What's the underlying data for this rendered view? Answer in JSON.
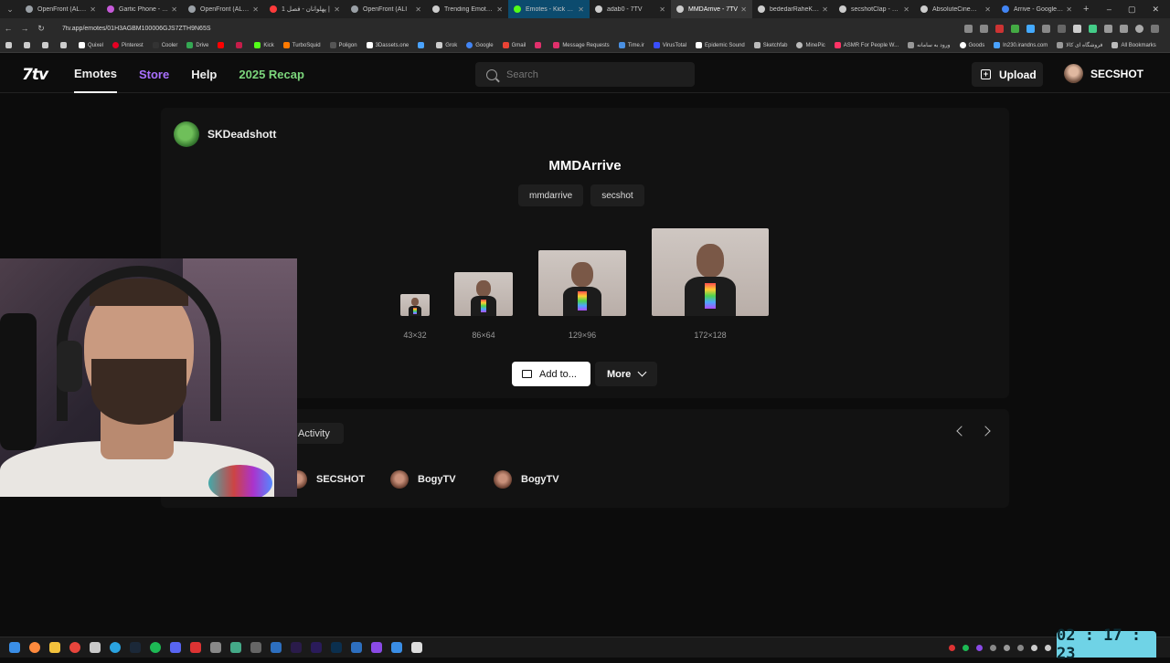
{
  "browser": {
    "tabs": [
      {
        "label": "OpenFront (ALPHA)",
        "color": "#9aa0a6"
      },
      {
        "label": "Gartic Phone - The",
        "color": "#c65ad9"
      },
      {
        "label": "OpenFront (ALPHA)",
        "color": "#9aa0a6"
      },
      {
        "label": "پهلوانان - فصل 1 |",
        "color": "#ff3b3b"
      },
      {
        "label": "OpenFront (ALI",
        "color": "#9aa0a6"
      },
      {
        "label": "Trending Emotes -",
        "color": "#cccccc"
      },
      {
        "label": "Emotes - Kick Dash",
        "color": "#53fc18"
      },
      {
        "label": "adab0 - 7TV",
        "color": "#cccccc"
      },
      {
        "label": "MMDArrive - 7TV",
        "color": "#cccccc"
      },
      {
        "label": "bededarRaheKhoda",
        "color": "#cccccc"
      },
      {
        "label": "secshotClap - 7TV",
        "color": "#cccccc"
      },
      {
        "label": "AbsoluteCinema -",
        "color": "#cccccc"
      },
      {
        "label": "Arrive - Google Sea",
        "color": "#4285f4"
      }
    ],
    "url": "7tv.app/emotes/01H3AGBM100006GJS7ZTH9N65S",
    "bookmarks": [
      {
        "label": "Quixel",
        "color": "#ffffff"
      },
      {
        "label": "Pinterest",
        "color": "#e60023"
      },
      {
        "label": "Cooler",
        "color": "#222222"
      },
      {
        "label": "Drive",
        "color": "#34a853"
      },
      {
        "label": "",
        "color": "#ff0000"
      },
      {
        "label": "",
        "color": "#c51d4a"
      },
      {
        "label": "Kick",
        "color": "#53fc18"
      },
      {
        "label": "TurboSquid",
        "color": "#ff7a00"
      },
      {
        "label": "Poligon",
        "color": "#444444"
      },
      {
        "label": "3Dassets.one",
        "color": "#ffffff"
      },
      {
        "label": "",
        "color": "#4aa3ff"
      },
      {
        "label": "Grok",
        "color": "#cccccc"
      },
      {
        "label": "Google",
        "color": "#4285f4"
      },
      {
        "label": "Gmail",
        "color": "#ea4335"
      },
      {
        "label": "",
        "color": "#e1306c"
      },
      {
        "label": "Message Requests",
        "color": "#e1306c"
      },
      {
        "label": "Time.ir",
        "color": "#4a90e2"
      },
      {
        "label": "VirusTotal",
        "color": "#394eff"
      },
      {
        "label": "Epidemic Sound",
        "color": "#ffffff"
      },
      {
        "label": "Sketchfab",
        "color": "#cccccc"
      },
      {
        "label": "MinePic",
        "color": "#bbbbbb"
      },
      {
        "label": "ASMR For People W...",
        "color": "#ff3366"
      },
      {
        "label": "ورود به سامانه",
        "color": "#999999"
      },
      {
        "label": "Goods",
        "color": "#ffffff"
      },
      {
        "label": "ln230.irandns.com",
        "color": "#4aa3ff"
      },
      {
        "label": "فروشگاه ای کالا",
        "color": "#999999"
      }
    ],
    "all_bookmarks": "All Bookmarks"
  },
  "site": {
    "logo": "7tv",
    "nav": [
      {
        "label": "Emotes"
      },
      {
        "label": "Store"
      },
      {
        "label": "Help"
      },
      {
        "label": "2025 Recap"
      }
    ],
    "search_placeholder": "Search",
    "upload_label": "Upload",
    "username": "SECSHOT"
  },
  "emote": {
    "owner": "SKDeadshott",
    "name": "MMDArrive",
    "tags": [
      "mmdarrive",
      "secshot"
    ],
    "sizes": [
      "43×32",
      "86×64",
      "129×96",
      "172×128"
    ],
    "add_label": "Add to...",
    "more_label": "More"
  },
  "activity": {
    "tab_label": "Activity",
    "users": [
      "SECSHOT",
      "BogyTV",
      "BogyTV"
    ]
  },
  "clock": "02 : 17 : 23",
  "colors": {
    "store_accent": "#a970ff",
    "recap_accent": "#7cd67c",
    "clock_bg": "#6fd3e6"
  }
}
